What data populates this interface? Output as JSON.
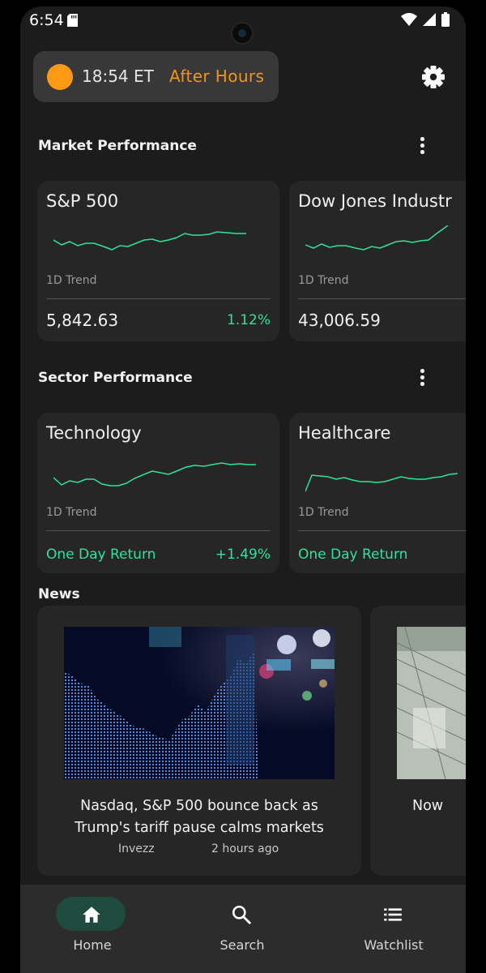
{
  "status_bar": {
    "time": "6:54"
  },
  "market_status": {
    "time": "18:54 ET",
    "session": "After Hours"
  },
  "market_performance": {
    "title": "Market Performance",
    "cards": [
      {
        "name": "S&P 500",
        "trend_label": "1D Trend",
        "value": "5,842.63",
        "change": "1.12%"
      },
      {
        "name": "Dow Jones Industr",
        "trend_label": "1D Trend",
        "value": "43,006.59"
      }
    ]
  },
  "sector_performance": {
    "title": "Sector Performance",
    "cards": [
      {
        "name": "Technology",
        "trend_label": "1D Trend",
        "return_label": "One Day Return",
        "return_value": "+1.49%"
      },
      {
        "name": "Healthcare",
        "trend_label": "1D Trend",
        "return_label": "One Day Return"
      }
    ]
  },
  "news": {
    "title": "News",
    "articles": [
      {
        "headline": "Nasdaq, S&P 500 bounce back as Trump's tariff pause calms markets",
        "source": "Invezz",
        "age": "2 hours ago"
      },
      {
        "headline": "Now"
      }
    ]
  },
  "bottom_nav": {
    "items": [
      {
        "label": "Home",
        "icon": "home-icon",
        "active": true
      },
      {
        "label": "Search",
        "icon": "search-icon"
      },
      {
        "label": "Watchlist",
        "icon": "list-icon"
      }
    ]
  },
  "colors": {
    "accent_green": "#2fe39a",
    "after_hours_orange": "#f0961e",
    "sun_orange": "#ff9913",
    "card_bg": "#262626",
    "screen_bg": "#1c1c1c"
  }
}
